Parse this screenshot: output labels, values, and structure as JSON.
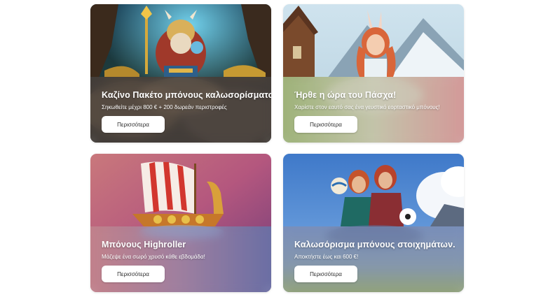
{
  "promotions": [
    {
      "title": "Καζίνο Πακέτο μπόνους καλωσορίσματος",
      "description": "Σηκωθείτε μέχρι 800 € + 200 δωρεάν περιστροφές",
      "button_label": "Περισσότερα",
      "image": "dwarf-warrior-in-cave"
    },
    {
      "title": "Ήρθε η ώρα του Πάσχα!",
      "description": "Χαρίστε στον εαυτό σας ένα γευστικό εορταστικό μπόνους!",
      "button_label": "Περισσότερα",
      "image": "bunny-eared-girl-in-mountains"
    },
    {
      "title": "Μπόνους Highroller",
      "description": "Μάζεψε ένα σωρό χρυσό κάθε εβδομάδα!",
      "button_label": "Περισσότερα",
      "image": "viking-ship"
    },
    {
      "title": "Καλωσόρισμα μπόνους στοιχημάτων.",
      "description": "Αποκτήστε έως και 600 €!",
      "button_label": "Περισσότερα",
      "image": "two-women-with-balls"
    }
  ]
}
